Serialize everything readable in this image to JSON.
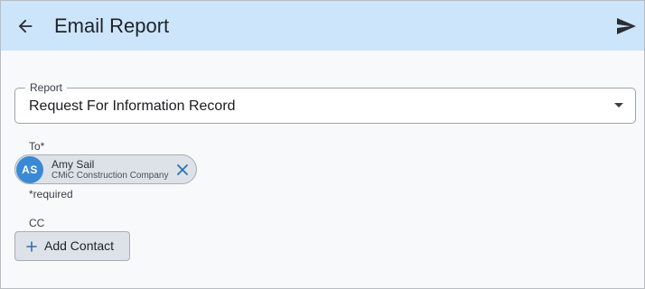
{
  "app_bar": {
    "title": "Email Report",
    "back_icon": "arrow-left-icon",
    "send_icon": "send-icon",
    "background": "#cde5fb"
  },
  "report_field": {
    "label": "Report",
    "value": "Request For Information Record",
    "dropdown_icon": "caret-down-icon"
  },
  "to_field": {
    "label": "To*",
    "helper_text": "*required",
    "recipients": [
      {
        "initials": "AS",
        "name": "Amy Sail",
        "company": "CMiC Construction Company",
        "avatar_color": "#3a8ad3",
        "remove_icon": "close-icon"
      }
    ]
  },
  "cc_field": {
    "label": "CC",
    "add_button_label": "Add Contact",
    "add_icon": "plus-icon"
  }
}
